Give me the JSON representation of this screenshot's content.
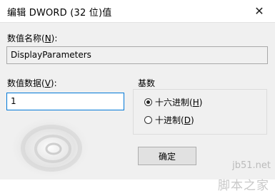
{
  "window": {
    "title": "编辑 DWORD (32 位)值",
    "close_glyph": "✕"
  },
  "value_name": {
    "label_prefix": "数值名称(",
    "label_key": "N",
    "label_suffix": "):",
    "value": "DisplayParameters"
  },
  "value_data": {
    "label_prefix": "数值数据(",
    "label_key": "V",
    "label_suffix": "):",
    "value": "1"
  },
  "base": {
    "title": "基数",
    "options": [
      {
        "prefix": "十六进制(",
        "key": "H",
        "suffix": ")",
        "selected": true
      },
      {
        "prefix": "十进制(",
        "key": "D",
        "suffix": ")",
        "selected": false
      }
    ]
  },
  "ok_button": {
    "label": "确定"
  },
  "watermark": {
    "line1": "jb51.net",
    "line2": "脚本之家"
  }
}
